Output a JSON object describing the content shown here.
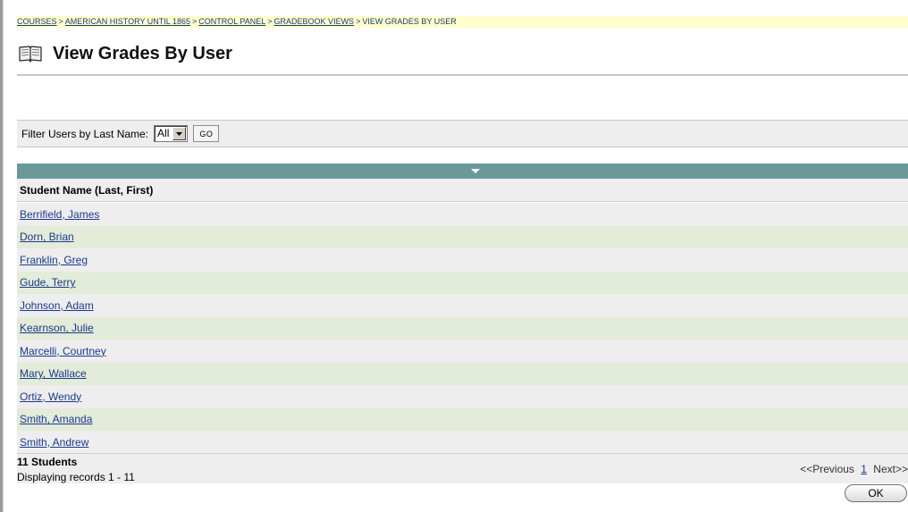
{
  "breadcrumb": {
    "items": [
      "COURSES",
      "AMERICAN HISTORY UNTIL 1865",
      "CONTROL PANEL",
      "GRADEBOOK VIEWS"
    ],
    "current": "VIEW GRADES BY USER",
    "separator": ">"
  },
  "page": {
    "title": "View Grades By User",
    "icon": "book-icon"
  },
  "filter": {
    "label": "Filter Users by Last Name:",
    "selected": "All",
    "go_label": "GO"
  },
  "table": {
    "column_header": "Student Name (Last, First)",
    "sort_indicator": "down-triangle",
    "rows": [
      "Berrifield, James",
      "Dorn, Brian",
      "Franklin, Greg",
      "Gude, Terry",
      "Johnson, Adam",
      "Kearnson, Julie",
      "Marcelli, Courtney",
      "Mary, Wallace",
      "Ortiz, Wendy",
      "Smith, Amanda",
      "Smith, Andrew"
    ]
  },
  "footer": {
    "count": "11 Students",
    "records": "Displaying records 1 - 11",
    "prev": "<<Previous",
    "page": "1",
    "next": "Next>>"
  },
  "ok_label": "OK",
  "colors": {
    "header_bar": "#6b9999",
    "row_alt": "#e3ebd9",
    "breadcrumb_bg": "#ffffcc",
    "link": "#1a3a8a"
  }
}
